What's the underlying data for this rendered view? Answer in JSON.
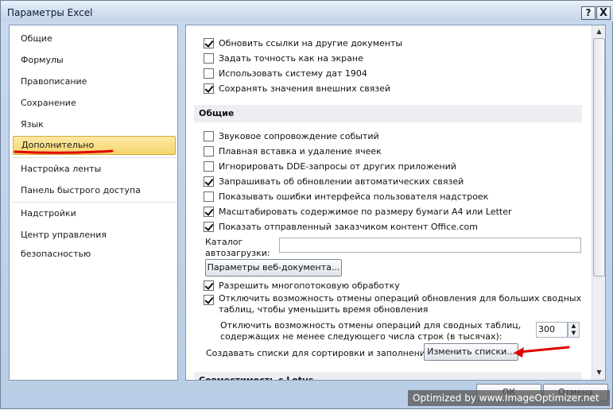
{
  "window": {
    "title": "Параметры Excel",
    "help_label": "?",
    "close_label": "X"
  },
  "nav": {
    "items": [
      {
        "label": "Общие"
      },
      {
        "label": "Формулы"
      },
      {
        "label": "Правописание"
      },
      {
        "label": "Сохранение"
      },
      {
        "label": "Язык"
      },
      {
        "label": "Дополнительно",
        "selected": true
      },
      {
        "label": "Настройка ленты"
      },
      {
        "label": "Панель быстрого доступа"
      },
      {
        "label": "Надстройки"
      },
      {
        "label": "Центр управления безопасностью"
      }
    ]
  },
  "content": {
    "top_options": [
      {
        "label": "Обновить ссылки на другие документы",
        "checked": true
      },
      {
        "label": "Задать точность как на экране",
        "checked": false
      },
      {
        "label": "Использовать систему дат 1904",
        "checked": false
      },
      {
        "label": "Сохранять значения внешних связей",
        "checked": true
      }
    ],
    "general_header": "Общие",
    "general_options": [
      {
        "label": "Звуковое сопровождение событий",
        "checked": false
      },
      {
        "label": "Плавная вставка и удаление ячеек",
        "checked": false
      },
      {
        "label": "Игнорировать DDE-запросы от других приложений",
        "checked": false
      },
      {
        "label": "Запрашивать об обновлении автоматических связей",
        "checked": true
      },
      {
        "label": "Показывать ошибки интерфейса пользователя надстроек",
        "checked": false
      },
      {
        "label": "Масштабировать содержимое по размеру бумаги A4 или Letter",
        "checked": true
      },
      {
        "label": "Показать отправленный заказчиком контент Office.com",
        "checked": true
      }
    ],
    "autoload_label_line1": "Каталог",
    "autoload_label_line2": "автозагрузки:",
    "autoload_value": "",
    "web_options_button": "Параметры веб-документа...",
    "multithread_label": "Разрешить многопотоковую обработку",
    "multithread_checked": true,
    "disable_undo_label_line1": "Отключить возможность отмены операций обновления для больших сводных",
    "disable_undo_label_line2": "таблиц, чтобы уменьшить время обновления",
    "disable_undo_checked": true,
    "pivot_rows_label_line1": "Отключить возможность отмены операций для сводных таблиц,",
    "pivot_rows_label_line2": "содержащих не менее следующего числа строк (в тысячах):",
    "pivot_rows_value": "300",
    "create_lists_label": "Создавать списки для сортировки и заполнения:",
    "edit_lists_button": "Изменить списки...",
    "next_section_header": "Совместимость с Lotus"
  },
  "footer": {
    "ok_label": "ОК",
    "cancel_label": "Отмена"
  },
  "watermark": "Optimized by www.ImageOptimizer.net",
  "colors": {
    "annotation_red": "#e00000",
    "selection": "#f7d56e",
    "titlebar": "#c4d5ea"
  }
}
